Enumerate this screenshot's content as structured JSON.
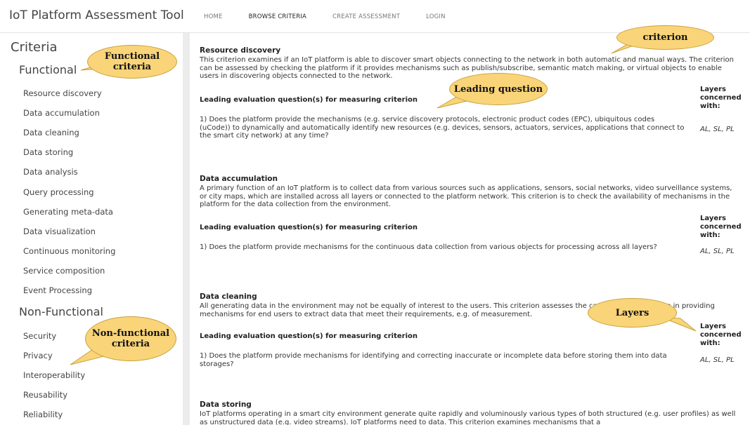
{
  "header": {
    "app_title": "IoT Platform Assessment Tool",
    "nav": [
      "HOME",
      "BROWSE CRITERIA",
      "CREATE ASSESSMENT",
      "LOGIN"
    ]
  },
  "sidebar": {
    "title": "Criteria",
    "functional_label": "Functional",
    "functional_items": [
      "Resource discovery",
      "Data accumulation",
      "Data cleaning",
      "Data storing",
      "Data analysis",
      "Query processing",
      "Generating meta-data",
      "Data visualization",
      "Continuous monitoring",
      "Service composition",
      "Event Processing"
    ],
    "nonfunctional_label": "Non-Functional",
    "nonfunctional_items": [
      "Security",
      "Privacy",
      "Interoperability",
      "Reusability",
      "Reliability"
    ]
  },
  "criteria": [
    {
      "title": "Resource discovery",
      "desc": "This criterion examines if an IoT platform is able to discover smart objects connecting to the network in both automatic and manual ways. The criterion can be assessed by checking the platform if it provides mechanisms such as publish/subscribe, semantic match making, or virtual objects to enable users in discovering objects connected to the network.",
      "leq": "Leading evaluation question(s) for measuring criterion",
      "layers_h": "Layers concerned with:",
      "question": "1) Does the platform provide the mechanisms (e.g. service discovery protocols, electronic product codes (EPC), ubiquitous codes (uCode)) to dynamically and automatically identify new resources (e.g. devices, sensors, actuators, services, applications that connect to the smart city network) at any time?",
      "layers": "AL, SL, PL"
    },
    {
      "title": "Data accumulation",
      "desc": "A primary function of an IoT platform is to collect data from various sources such as applications, sensors, social networks, video surveillance systems, or city maps, which are installed across all layers or connected to the platform network. This criterion is to check the availability of mechanisms in the platform for the data collection from the environment.",
      "leq": "Leading evaluation question(s) for measuring criterion",
      "layers_h": "Layers concerned with:",
      "question": "1) Does the platform provide mechanisms for the continuous data collection from various objects for processing across all layers?",
      "layers": "AL, SL, PL"
    },
    {
      "title": "Data cleaning",
      "desc": "All generating data in the environment may not be equally of interest to the users. This criterion assesses the capability of a platform in providing mechanisms for end users to extract data that meet their requirements, e.g. of measurement.",
      "leq": "Leading evaluation question(s) for measuring criterion",
      "layers_h": "Layers concerned with:",
      "question": "1) Does the platform provide mechanisms for identifying and correcting inaccurate or incomplete data before storing them into data storages?",
      "layers": "AL, SL, PL"
    },
    {
      "title": "Data storing",
      "desc": "IoT platforms operating in a smart city environment generate quite rapidly and voluminously various types of both structured (e.g. user profiles) as well as unstructured data (e.g. video streams). IoT platforms need to data. This criterion examines mechanisms that a"
    }
  ],
  "callouts": {
    "criterion": "criterion",
    "functional": "Functional criteria",
    "leading": "Leading question",
    "layers": "Layers",
    "nonfunctional": "Non-functional criteria"
  },
  "colors": {
    "callout_fill": "#f9d479",
    "callout_border": "#c9a23e",
    "content_bg": "#ececec"
  }
}
